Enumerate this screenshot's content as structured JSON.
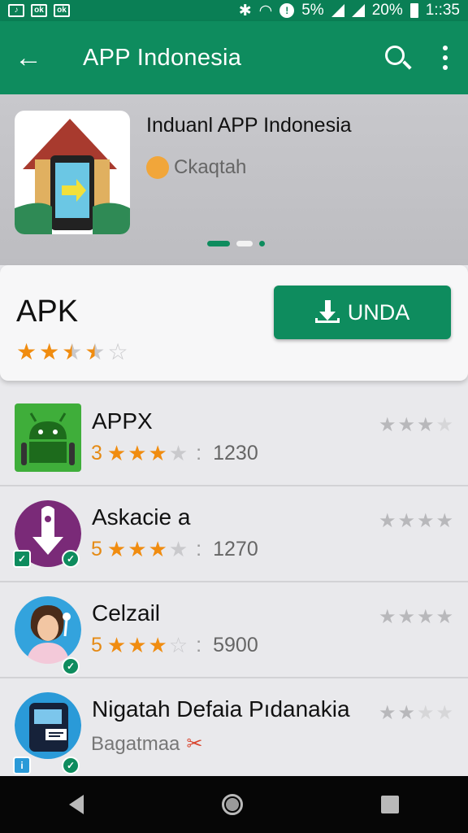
{
  "status_bar": {
    "left_icons": [
      "🎵",
      "ok",
      "ok"
    ],
    "battery_1": "5%",
    "battery_2": "20%",
    "time": "1::35"
  },
  "app_bar": {
    "title": "APP Indonesia",
    "back_icon": "arrow-back-icon",
    "search_icon": "search-icon",
    "more_icon": "more-vert-icon"
  },
  "banner": {
    "title": "Induanl APP Indonesia",
    "subtitle": "Ckaqtah",
    "carousel_pages": 3,
    "carousel_active": 0
  },
  "featured": {
    "title": "APK",
    "rating": 2.5,
    "button_label": "UNDA"
  },
  "list": [
    {
      "name": "APPX",
      "score": "3",
      "rating": 3,
      "count": "1230",
      "icon": "android-icon",
      "right_rating": 3
    },
    {
      "name": "Askacie a",
      "score": "5",
      "rating": 3,
      "count": "1270",
      "icon": "download-pin-icon",
      "right_rating": 4
    },
    {
      "name": "Celzail",
      "score": "5",
      "rating": 3,
      "count": "5900",
      "icon": "avatar-woman-icon",
      "right_rating": 4
    },
    {
      "name": "Nigatah Defaia Pıdanakia",
      "subtitle": "Bagatmaa",
      "icon": "tablet-icon",
      "right_rating": 2
    }
  ],
  "colors": {
    "primary": "#0e8c5e",
    "status": "#0a7f55",
    "star": "#f08c10"
  }
}
